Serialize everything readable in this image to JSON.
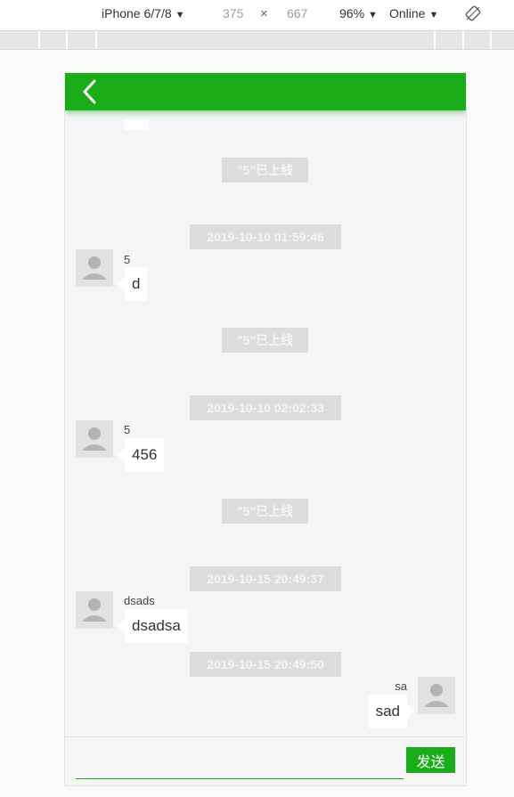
{
  "devtools": {
    "device": "iPhone 6/7/8",
    "width": "375",
    "times": "×",
    "height": "667",
    "zoom": "96%",
    "throttle": "Online",
    "caret": "▼"
  },
  "chat": {
    "system_messages": [
      "\"5\"已上线",
      "\"5\"已上线",
      "\"5\"已上线"
    ],
    "timestamps": [
      "2019-10-10 01:59:46",
      "2019-10-10 02:02:33",
      "2019-10-15 20:49:37",
      "2019-10-15 20:49:50"
    ],
    "messages": [
      {
        "user": "5",
        "text": "d",
        "side": "left"
      },
      {
        "user": "5",
        "text": "456",
        "side": "left"
      },
      {
        "user": "dsads",
        "text": "dsadsa",
        "side": "left"
      },
      {
        "user": "sa",
        "text": "sad",
        "side": "right"
      }
    ]
  },
  "footer": {
    "input_value": "",
    "send_label": "发送"
  },
  "colors": {
    "accent": "#1aad19",
    "system_bg": "#dcdcdc",
    "chat_bg": "#f5f5f5"
  }
}
